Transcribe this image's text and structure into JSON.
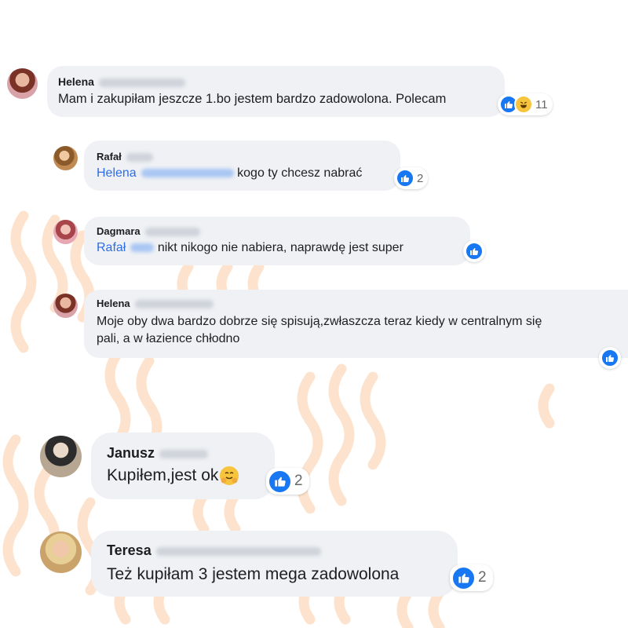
{
  "comments": [
    {
      "name": "Helena",
      "text": "Mam i zakupiłam jeszcze 1.bo jestem bardzo zadowolona. Polecam",
      "reaction_count": "11",
      "reactions": [
        "like-icon",
        "haha-icon"
      ]
    },
    {
      "name": "Rafał",
      "mention": "Helena",
      "text": "kogo ty chcesz nabrać",
      "reaction_count": "2",
      "reactions": [
        "like-icon"
      ]
    },
    {
      "name": "Dagmara",
      "mention": "Rafał",
      "text": "nikt nikogo nie nabiera, naprawdę jest super",
      "reactions": [
        "like-icon"
      ]
    },
    {
      "name": "Helena",
      "text_line1": "Moje oby dwa bardzo dobrze się spisują,zwłaszcza teraz kiedy w centralnym się",
      "text_line2": "pali, a w łazience chłodno",
      "reactions": [
        "like-icon"
      ]
    },
    {
      "name": "Janusz",
      "text": "Kupiłem,jest ok",
      "emoji": "hugging-face-icon",
      "reaction_count": "2",
      "reactions": [
        "like-icon"
      ]
    },
    {
      "name": "Teresa",
      "text": "Też kupiłam 3 jestem mega zadowolona",
      "reaction_count": "2",
      "reactions": [
        "like-icon"
      ]
    }
  ],
  "colors": {
    "bubble": "#eff1f4",
    "mention": "#2d6ee6",
    "like": "#1877f2",
    "wave": "#fde3cd"
  }
}
